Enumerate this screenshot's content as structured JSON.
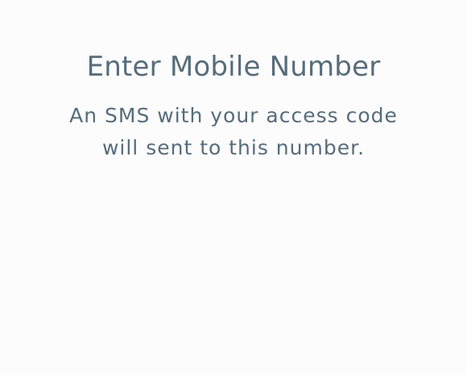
{
  "screen": {
    "title": "Enter Mobile Number",
    "subtitle": "An SMS with your access code will sent to this number.",
    "colors": {
      "background": "#fcfcfd",
      "text": "#566c7a"
    }
  }
}
